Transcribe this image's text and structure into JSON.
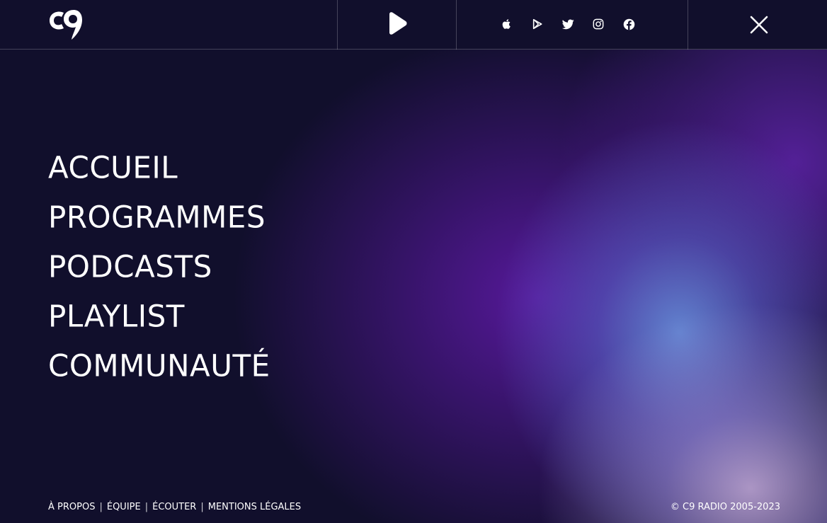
{
  "header": {
    "logo_text": "c9",
    "play_button_icon": "play-icon",
    "socials": [
      {
        "icon": "apple-icon",
        "label": "Apple Podcasts"
      },
      {
        "icon": "google-play-icon",
        "label": "Google Play"
      },
      {
        "icon": "twitter-icon",
        "label": "Twitter"
      },
      {
        "icon": "instagram-icon",
        "label": "Instagram"
      },
      {
        "icon": "facebook-icon",
        "label": "Facebook"
      }
    ],
    "close_icon": "close-icon"
  },
  "nav": {
    "items": [
      {
        "label": "ACCUEIL"
      },
      {
        "label": "PROGRAMMES"
      },
      {
        "label": "PODCASTS"
      },
      {
        "label": "PLAYLIST"
      },
      {
        "label": "COMMUNAUTÉ"
      }
    ]
  },
  "footer": {
    "links": [
      {
        "label": "À PROPOS"
      },
      {
        "label": "ÉQUIPE"
      },
      {
        "label": "ÉCOUTER"
      },
      {
        "label": "MENTIONS LÉGALES"
      }
    ],
    "separator": "|",
    "copyright": "© C9 RADIO 2005-2023"
  },
  "colors": {
    "background": "#110f2c",
    "text": "#ffffff",
    "glow_purple": "#5a19a0",
    "glow_blue": "#6996e1",
    "glow_lilac": "#c4aada"
  }
}
